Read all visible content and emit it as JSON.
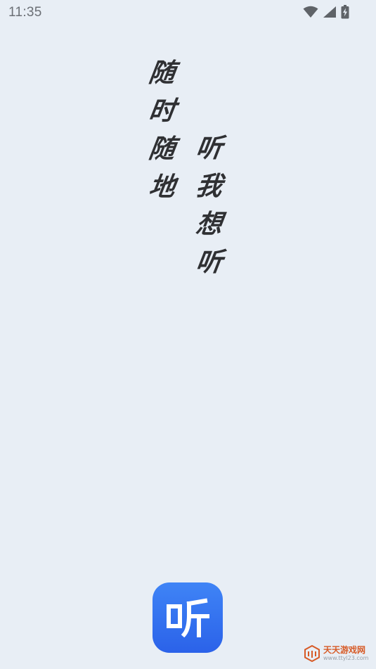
{
  "status_bar": {
    "time": "11:35",
    "icons": [
      "wifi-icon",
      "cell-signal-icon",
      "battery-charging-icon"
    ]
  },
  "slogan": {
    "left_column": [
      "随",
      "时",
      "随",
      "地"
    ],
    "right_column": [
      "听",
      "我",
      "想",
      "听"
    ]
  },
  "app_logo": {
    "glyph": "听",
    "colors": {
      "top": "#3f84f6",
      "bottom": "#2b62e9"
    }
  },
  "watermark": {
    "title": "天天游戏网",
    "url": "www.ttyl23.com"
  },
  "colors": {
    "background": "#e8eef5",
    "text": "#2f3033",
    "accent": "#2b62e9"
  }
}
